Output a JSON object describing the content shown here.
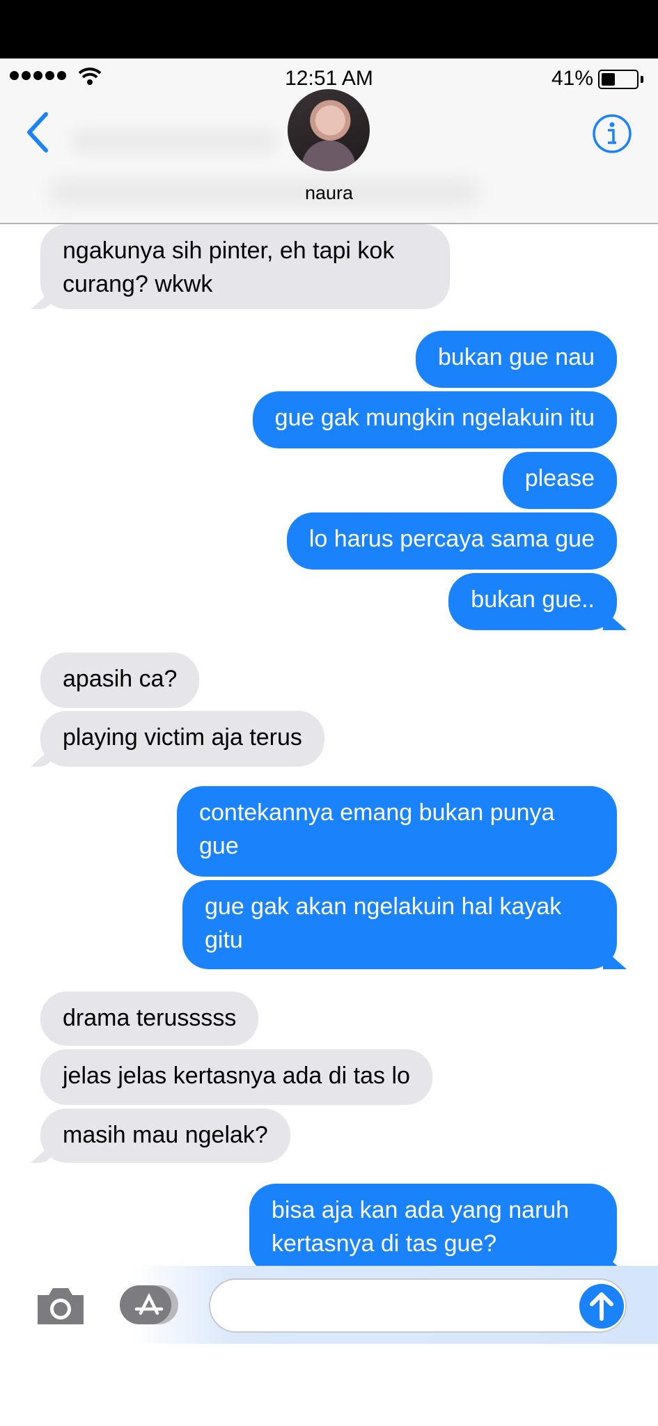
{
  "status_bar": {
    "time": "12:51 AM",
    "battery": "41%",
    "battery_level": 0.41
  },
  "header": {
    "contact_name": "naura",
    "back_icon": "chevron-left-icon",
    "info_icon": "info-icon"
  },
  "colors": {
    "accent": "#1a82fb",
    "incoming_bubble": "#e5e5ea",
    "outgoing_bubble": "#1a82fb"
  },
  "messages": [
    {
      "dir": "in",
      "text": "ngakunya sih pinter, eh tapi kok\ncurang? wkwk"
    },
    {
      "dir": "out",
      "text": "bukan gue nau"
    },
    {
      "dir": "out",
      "text": "gue gak mungkin ngelakuin itu"
    },
    {
      "dir": "out",
      "text": "please"
    },
    {
      "dir": "out",
      "text": "lo harus percaya sama gue"
    },
    {
      "dir": "out",
      "text": "bukan gue.."
    },
    {
      "dir": "in",
      "text": "apasih ca?"
    },
    {
      "dir": "in",
      "text": "playing victim aja terus"
    },
    {
      "dir": "out",
      "text": "contekannya emang bukan punya\ngue"
    },
    {
      "dir": "out",
      "text": "gue gak akan ngelakuin hal kayak\ngitu"
    },
    {
      "dir": "in",
      "text": "drama terusssss"
    },
    {
      "dir": "in",
      "text": "jelas jelas kertasnya ada di tas lo"
    },
    {
      "dir": "in",
      "text": "masih mau ngelak?"
    },
    {
      "dir": "out",
      "text": "bisa aja kan ada yang naruh\nkertasnya di tas gue?"
    }
  ],
  "compose": {
    "message_value": "",
    "camera_icon": "camera-icon",
    "appstore_icon": "appstore-icon",
    "send_icon": "send-arrow-icon"
  }
}
